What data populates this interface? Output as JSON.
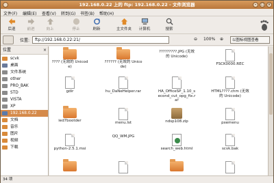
{
  "window": {
    "title": "192.168.0.22 上的 ftp: 192.168.0.22 - 文件浏览器"
  },
  "menubar": [
    "文件(F)",
    "编辑(E)",
    "查看(V)",
    "转到(G)",
    "书签(B)",
    "帮助(H)"
  ],
  "toolbar": {
    "back": "后退",
    "forward": "前进",
    "up": "向上",
    "stop": "停止",
    "reload": "刷新",
    "home": "主文件夹",
    "computer": "计算机",
    "search": "搜索"
  },
  "location": {
    "label": "位置:",
    "value": "ftp://192.168.0.22:21/",
    "zoom": "100%",
    "view": "以图标视图查看"
  },
  "sidebar": {
    "header": "位置",
    "items": [
      {
        "label": "scvk",
        "color": "#d98a3a"
      },
      {
        "label": "桌面",
        "color": "#6a7a9a"
      },
      {
        "label": "文件系统",
        "color": "#8a8a8a"
      },
      {
        "label": "other",
        "color": "#8a8a8a"
      },
      {
        "label": "PRO_BAK",
        "color": "#8a8a8a"
      },
      {
        "label": "STD",
        "color": "#8a8a8a"
      },
      {
        "label": "VISTA",
        "color": "#8a8a8a"
      },
      {
        "label": "XP",
        "color": "#8a8a8a"
      },
      {
        "label": "192.168.0.22",
        "color": "#5a7aaa"
      },
      {
        "label": "文档",
        "color": "#d98a3a"
      },
      {
        "label": "音乐",
        "color": "#d98a3a"
      },
      {
        "label": "图片",
        "color": "#d98a3a"
      },
      {
        "label": "视频",
        "color": "#d98a3a"
      },
      {
        "label": "下载",
        "color": "#d98a3a"
      }
    ],
    "selected_index": 8
  },
  "files": [
    {
      "name": "???? (无效的 Unicode)",
      "kind": "folder"
    },
    {
      "name": "?????? (无效的 Unicode)",
      "kind": "folder"
    },
    {
      "name": "?????????.JPG (无效的 Unicode)",
      "kind": "image"
    },
    {
      "name": "FSCK0000.REC",
      "kind": "doc"
    },
    {
      "name": "gdir",
      "kind": "doc"
    },
    {
      "name": "hu_DaNeHelper.rar",
      "kind": "doc"
    },
    {
      "name": "HA_OfficeSP_1.10_second_cut_opg_fix.rar",
      "kind": "doc"
    },
    {
      "name": "HTML????.chm (无效的 Unicode)",
      "kind": "doc"
    },
    {
      "name": "ied7bootder",
      "kind": "folder"
    },
    {
      "name": "menu.lst",
      "kind": "doc"
    },
    {
      "name": "ndsp108.zip",
      "kind": "pkg"
    },
    {
      "name": "pxemenu",
      "kind": "doc"
    },
    {
      "name": "python-2.5.1.msi",
      "kind": "doc"
    },
    {
      "name": "QQ_WM.JPG",
      "kind": "image"
    },
    {
      "name": "search_web.html",
      "kind": "web"
    },
    {
      "name": "scvk.bak",
      "kind": "doc"
    },
    {
      "name": "",
      "kind": "folder"
    },
    {
      "name": "",
      "kind": "doc"
    },
    {
      "name": "",
      "kind": "folder"
    },
    {
      "name": "",
      "kind": "doc"
    }
  ],
  "status": "34 项"
}
